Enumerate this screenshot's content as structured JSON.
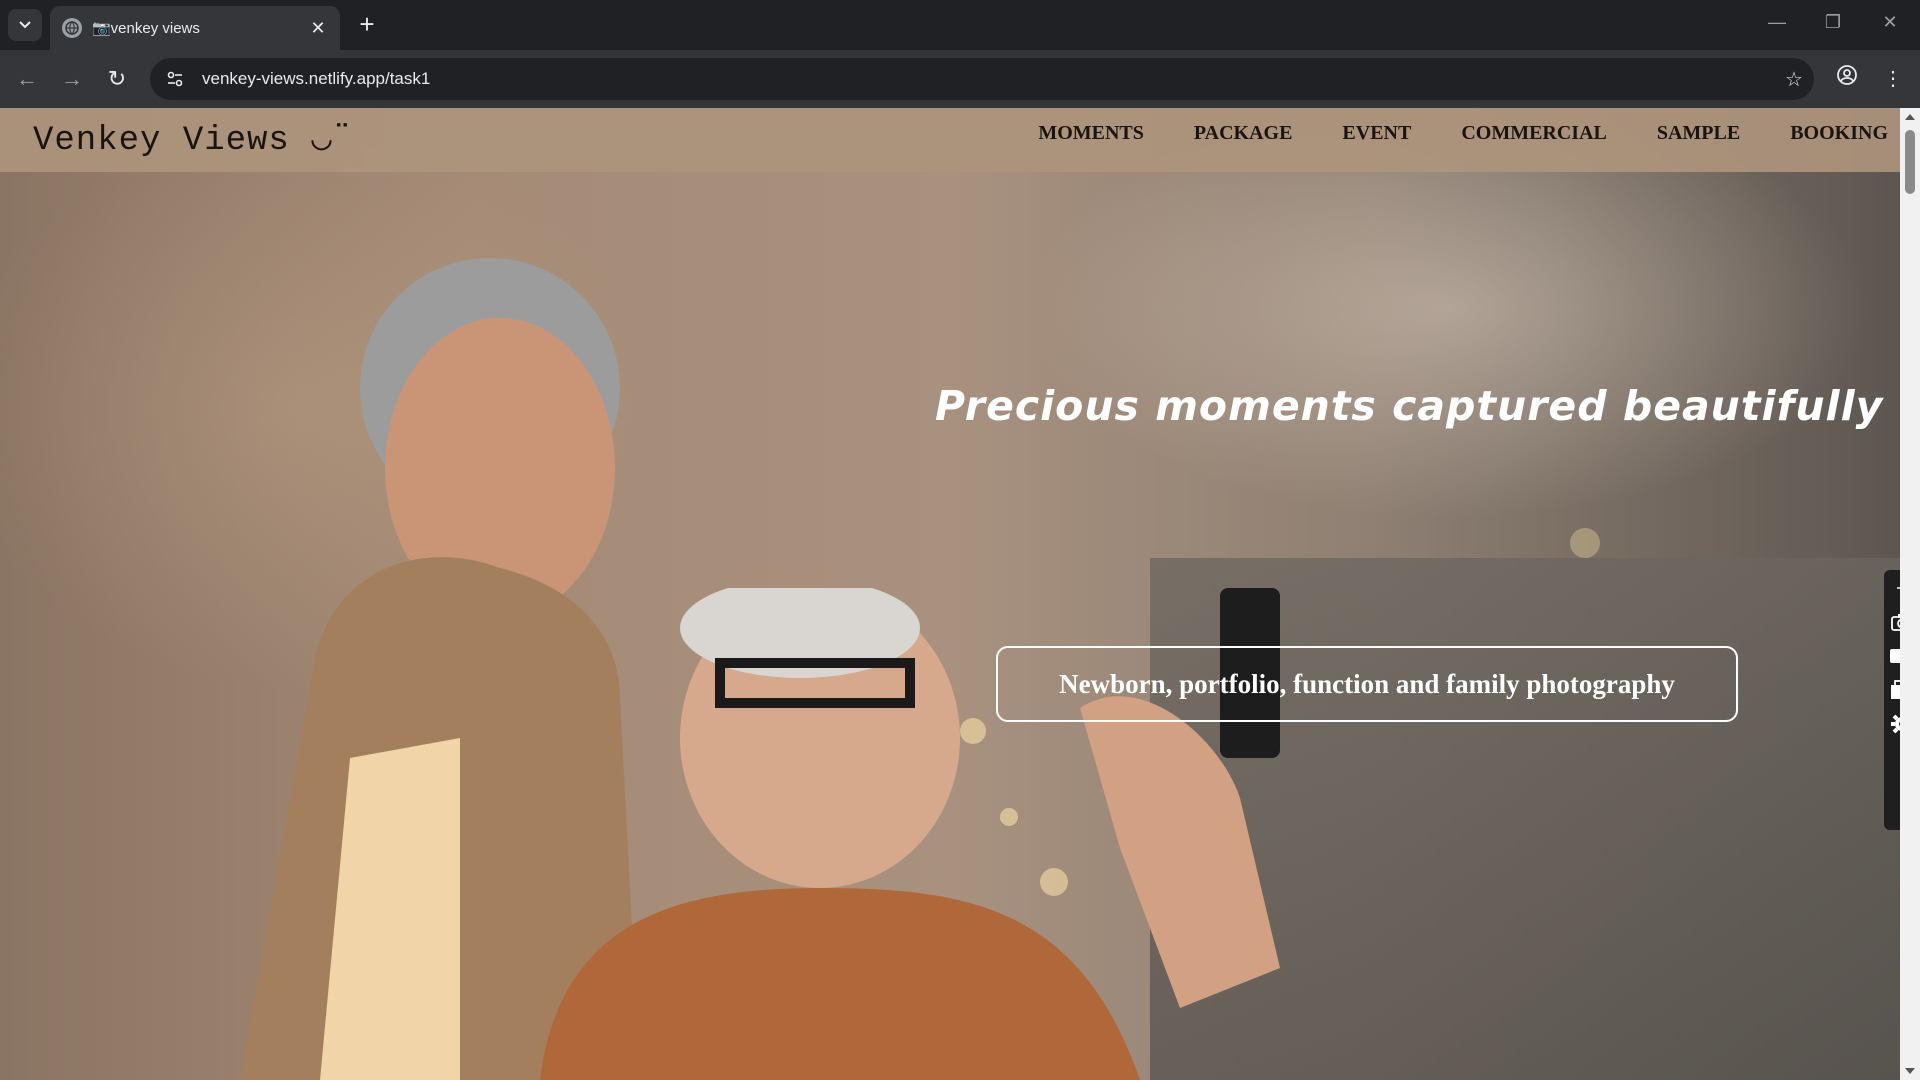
{
  "browser": {
    "tab_title": "📷venkey views",
    "url": "venkey-views.netlify.app/task1"
  },
  "site": {
    "logo": "Venkey Views ◡̈",
    "nav": [
      "MOMENTS",
      "PACKAGE",
      "EVENT",
      "COMMERCIAL",
      "SAMPLE",
      "BOOKING"
    ],
    "hero_title": "Precious moments captured beautifully :)",
    "hero_subtitle": "Newborn, portfolio, function and family photography"
  },
  "icons": {
    "tab_search": "chevron-down-icon",
    "favicon": "globe-icon",
    "tab_close": "close-icon",
    "new_tab": "plus-icon",
    "back": "back-arrow-icon",
    "forward": "forward-arrow-icon",
    "reload": "reload-icon",
    "site_info": "tune-icon",
    "bookmark": "star-icon",
    "profile": "profile-icon",
    "menu": "more-vert-icon",
    "side_tools": [
      "link-icon",
      "camera-icon",
      "video-icon",
      "window-icon",
      "gear-icon"
    ]
  }
}
